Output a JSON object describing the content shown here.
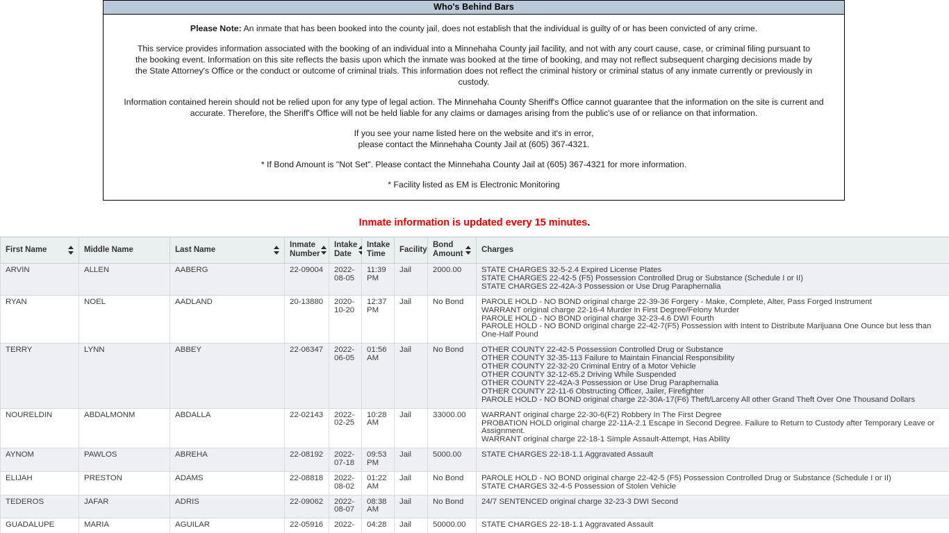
{
  "notice": {
    "title": "Who's Behind Bars",
    "please_note_label": "Please Note:",
    "please_note_text": " An inmate that has been booked into the county jail, does not establish that the individual is guilty of or has been convicted of any crime.",
    "paragraph_service": "This service provides information associated with the booking of an individual into a Minnehaha County jail facility, and not with any court cause, case, or criminal filing pursuant to the booking event. Information on this site reflects the basis upon which the inmate was booked at the time of booking, and may not reflect subsequent charging decisions made by the State Attorney's Office or the conduct or outcome of criminal trials. This information does not reflect the criminal history or criminal status of any inmate currently or previously in custody.",
    "paragraph_legal": "Information contained herein should not be relied upon for any type of legal action. The Minnehaha County Sheriff's Office cannot guarantee that the information on the site is current and accurate. Therefore, the Sheriff's Office will not be held liable for any claims or damages arising from the public's use of or reliance on that information.",
    "error_line1": "If you see your name listed here on the website and it's in error,",
    "error_line2": "please contact the Minnehaha County Jail at (605) 367-4321.",
    "bond_note": "* If Bond Amount is \"Not Set\". Please contact the Minnehaha County Jail at (605) 367-4321 for more information.",
    "em_note": "* Facility listed as EM is Electronic Monitoring"
  },
  "update_banner": {
    "text": "Inmate information is updated every 15 minutes",
    "period": ".",
    "color": "#e60000"
  },
  "table": {
    "columns": [
      {
        "label": "First Name",
        "sortable": true
      },
      {
        "label": "Middle Name",
        "sortable": false
      },
      {
        "label": "Last Name",
        "sortable": true
      },
      {
        "label": "Inmate Number",
        "sortable": true
      },
      {
        "label": "Intake Date",
        "sortable": true
      },
      {
        "label": "Intake Time",
        "sortable": false
      },
      {
        "label": "Facility",
        "sortable": true
      },
      {
        "label": "Bond Amount",
        "sortable": true
      },
      {
        "label": "Charges",
        "sortable": false
      }
    ],
    "rows": [
      {
        "first_name": "ARVIN",
        "middle_name": "ALLEN",
        "last_name": "AABERG",
        "inmate_number": "22-09004",
        "intake_date": "2022-08-05",
        "intake_time": "11:39 PM",
        "facility": "Jail",
        "bond_amount": "2000.00",
        "charges": [
          "STATE CHARGES 32-5-2.4 Expired License Plates",
          "STATE CHARGES 22-42-5 (F5) Possession Controlled Drug or Substance (Schedule I or II)",
          "STATE CHARGES 22-42A-3 Possession or Use Drug Paraphernalia"
        ]
      },
      {
        "first_name": "RYAN",
        "middle_name": "NOEL",
        "last_name": "AADLAND",
        "inmate_number": "20-13880",
        "intake_date": "2020-10-20",
        "intake_time": "12:37 PM",
        "facility": "Jail",
        "bond_amount": "No Bond",
        "charges": [
          "PAROLE HOLD - NO BOND original charge 22-39-36 Forgery - Make, Complete, Alter, Pass Forged Instrument",
          "WARRANT original charge 22-16-4 Murder in First Degree/Felony Murder",
          "PAROLE HOLD - NO BOND original charge 32-23-4.6 DWI Fourth",
          "PAROLE HOLD - NO BOND original charge 22-42-7(F5) Possession with Intent to Distribute Marijuana One Ounce but less than One-Half Pound"
        ]
      },
      {
        "first_name": "TERRY",
        "middle_name": "LYNN",
        "last_name": "ABBEY",
        "inmate_number": "22-06347",
        "intake_date": "2022-06-05",
        "intake_time": "01:56 AM",
        "facility": "Jail",
        "bond_amount": "No Bond",
        "charges": [
          "OTHER COUNTY 22-42-5 Possession Controlled Drug or Substance",
          "OTHER COUNTY 32-35-113 Failure to Maintain Financial Responsibility",
          "OTHER COUNTY 22-32-20 Criminal Entry of a Motor Vehicle",
          "OTHER COUNTY 32-12-65.2 Driving While Suspended",
          "OTHER COUNTY 22-42A-3 Possession or Use Drug Paraphernalia",
          "OTHER COUNTY 22-11-6 Obstructing Officer, Jailer, Firefighter",
          "PAROLE HOLD - NO BOND original charge 22-30A-17(F6) Theft/Larceny All other Grand Theft Over One Thousand Dollars"
        ]
      },
      {
        "first_name": "NOURELDIN",
        "middle_name": "ABDALMONM",
        "last_name": "ABDALLA",
        "inmate_number": "22-02143",
        "intake_date": "2022-02-25",
        "intake_time": "10:28 AM",
        "facility": "Jail",
        "bond_amount": "33000.00",
        "charges": [
          "WARRANT original charge 22-30-6(F2) Robbery In The First Degree",
          "PROBATION HOLD original charge 22-11A-2.1 Escape in Second Degree. Failure to Return to Custody after Temporary Leave or Assignment.",
          "WARRANT original charge 22-18-1 Simple Assault-Attempt, Has Ability"
        ]
      },
      {
        "first_name": "AYNOM",
        "middle_name": "PAWLOS",
        "last_name": "ABREHA",
        "inmate_number": "22-08192",
        "intake_date": "2022-07-18",
        "intake_time": "09:53 PM",
        "facility": "Jail",
        "bond_amount": "5000.00",
        "charges": [
          "STATE CHARGES 22-18-1.1 Aggravated Assault"
        ]
      },
      {
        "first_name": "ELIJAH",
        "middle_name": "PRESTON",
        "last_name": "ADAMS",
        "inmate_number": "22-08818",
        "intake_date": "2022-08-02",
        "intake_time": "01:22 AM",
        "facility": "Jail",
        "bond_amount": "No Bond",
        "charges": [
          "PAROLE HOLD - NO BOND original charge 22-42-5 (F5) Possession Controlled Drug or Substance (Schedule I or II)",
          "STATE CHARGES 32-4-5 Possession of Stolen Vehicle"
        ]
      },
      {
        "first_name": "TEDEROS",
        "middle_name": "JAFAR",
        "last_name": "ADRIS",
        "inmate_number": "22-09062",
        "intake_date": "2022-08-07",
        "intake_time": "08:38 AM",
        "facility": "Jail",
        "bond_amount": "No Bond",
        "charges": [
          "24/7 SENTENCED original charge 32-23-3 DWI Second"
        ]
      },
      {
        "first_name": "GUADALUPE",
        "middle_name": "MARIA",
        "last_name": "AGUILAR",
        "inmate_number": "22-05916",
        "intake_date": "2022-",
        "intake_time": "04:28",
        "facility": "Jail",
        "bond_amount": "50000.00",
        "charges": [
          "STATE CHARGES 22-18-1.1 Aggravated Assault"
        ]
      }
    ]
  }
}
